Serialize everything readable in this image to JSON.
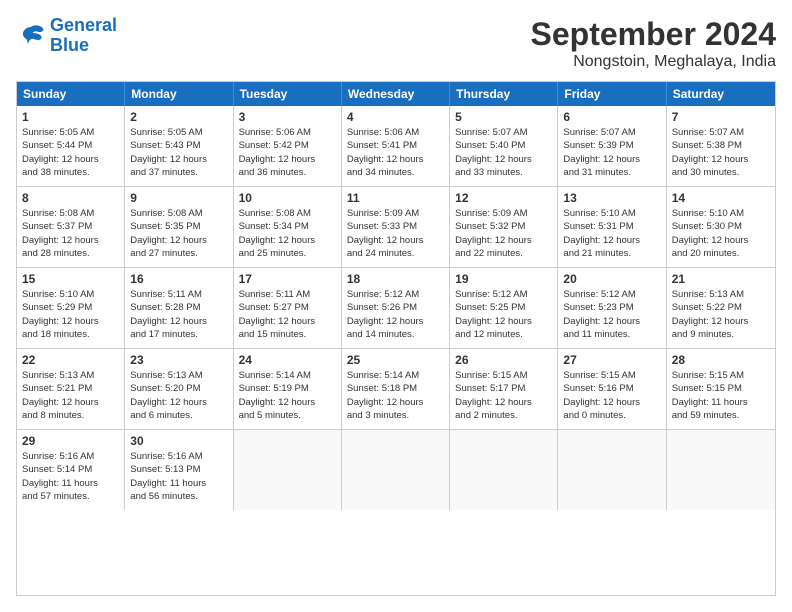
{
  "logo": {
    "line1": "General",
    "line2": "Blue"
  },
  "title": "September 2024",
  "subtitle": "Nongstoin, Meghalaya, India",
  "days": [
    "Sunday",
    "Monday",
    "Tuesday",
    "Wednesday",
    "Thursday",
    "Friday",
    "Saturday"
  ],
  "weeks": [
    [
      {
        "num": "1",
        "lines": [
          "Sunrise: 5:05 AM",
          "Sunset: 5:44 PM",
          "Daylight: 12 hours",
          "and 38 minutes."
        ]
      },
      {
        "num": "2",
        "lines": [
          "Sunrise: 5:05 AM",
          "Sunset: 5:43 PM",
          "Daylight: 12 hours",
          "and 37 minutes."
        ]
      },
      {
        "num": "3",
        "lines": [
          "Sunrise: 5:06 AM",
          "Sunset: 5:42 PM",
          "Daylight: 12 hours",
          "and 36 minutes."
        ]
      },
      {
        "num": "4",
        "lines": [
          "Sunrise: 5:06 AM",
          "Sunset: 5:41 PM",
          "Daylight: 12 hours",
          "and 34 minutes."
        ]
      },
      {
        "num": "5",
        "lines": [
          "Sunrise: 5:07 AM",
          "Sunset: 5:40 PM",
          "Daylight: 12 hours",
          "and 33 minutes."
        ]
      },
      {
        "num": "6",
        "lines": [
          "Sunrise: 5:07 AM",
          "Sunset: 5:39 PM",
          "Daylight: 12 hours",
          "and 31 minutes."
        ]
      },
      {
        "num": "7",
        "lines": [
          "Sunrise: 5:07 AM",
          "Sunset: 5:38 PM",
          "Daylight: 12 hours",
          "and 30 minutes."
        ]
      }
    ],
    [
      {
        "num": "8",
        "lines": [
          "Sunrise: 5:08 AM",
          "Sunset: 5:37 PM",
          "Daylight: 12 hours",
          "and 28 minutes."
        ]
      },
      {
        "num": "9",
        "lines": [
          "Sunrise: 5:08 AM",
          "Sunset: 5:35 PM",
          "Daylight: 12 hours",
          "and 27 minutes."
        ]
      },
      {
        "num": "10",
        "lines": [
          "Sunrise: 5:08 AM",
          "Sunset: 5:34 PM",
          "Daylight: 12 hours",
          "and 25 minutes."
        ]
      },
      {
        "num": "11",
        "lines": [
          "Sunrise: 5:09 AM",
          "Sunset: 5:33 PM",
          "Daylight: 12 hours",
          "and 24 minutes."
        ]
      },
      {
        "num": "12",
        "lines": [
          "Sunrise: 5:09 AM",
          "Sunset: 5:32 PM",
          "Daylight: 12 hours",
          "and 22 minutes."
        ]
      },
      {
        "num": "13",
        "lines": [
          "Sunrise: 5:10 AM",
          "Sunset: 5:31 PM",
          "Daylight: 12 hours",
          "and 21 minutes."
        ]
      },
      {
        "num": "14",
        "lines": [
          "Sunrise: 5:10 AM",
          "Sunset: 5:30 PM",
          "Daylight: 12 hours",
          "and 20 minutes."
        ]
      }
    ],
    [
      {
        "num": "15",
        "lines": [
          "Sunrise: 5:10 AM",
          "Sunset: 5:29 PM",
          "Daylight: 12 hours",
          "and 18 minutes."
        ]
      },
      {
        "num": "16",
        "lines": [
          "Sunrise: 5:11 AM",
          "Sunset: 5:28 PM",
          "Daylight: 12 hours",
          "and 17 minutes."
        ]
      },
      {
        "num": "17",
        "lines": [
          "Sunrise: 5:11 AM",
          "Sunset: 5:27 PM",
          "Daylight: 12 hours",
          "and 15 minutes."
        ]
      },
      {
        "num": "18",
        "lines": [
          "Sunrise: 5:12 AM",
          "Sunset: 5:26 PM",
          "Daylight: 12 hours",
          "and 14 minutes."
        ]
      },
      {
        "num": "19",
        "lines": [
          "Sunrise: 5:12 AM",
          "Sunset: 5:25 PM",
          "Daylight: 12 hours",
          "and 12 minutes."
        ]
      },
      {
        "num": "20",
        "lines": [
          "Sunrise: 5:12 AM",
          "Sunset: 5:23 PM",
          "Daylight: 12 hours",
          "and 11 minutes."
        ]
      },
      {
        "num": "21",
        "lines": [
          "Sunrise: 5:13 AM",
          "Sunset: 5:22 PM",
          "Daylight: 12 hours",
          "and 9 minutes."
        ]
      }
    ],
    [
      {
        "num": "22",
        "lines": [
          "Sunrise: 5:13 AM",
          "Sunset: 5:21 PM",
          "Daylight: 12 hours",
          "and 8 minutes."
        ]
      },
      {
        "num": "23",
        "lines": [
          "Sunrise: 5:13 AM",
          "Sunset: 5:20 PM",
          "Daylight: 12 hours",
          "and 6 minutes."
        ]
      },
      {
        "num": "24",
        "lines": [
          "Sunrise: 5:14 AM",
          "Sunset: 5:19 PM",
          "Daylight: 12 hours",
          "and 5 minutes."
        ]
      },
      {
        "num": "25",
        "lines": [
          "Sunrise: 5:14 AM",
          "Sunset: 5:18 PM",
          "Daylight: 12 hours",
          "and 3 minutes."
        ]
      },
      {
        "num": "26",
        "lines": [
          "Sunrise: 5:15 AM",
          "Sunset: 5:17 PM",
          "Daylight: 12 hours",
          "and 2 minutes."
        ]
      },
      {
        "num": "27",
        "lines": [
          "Sunrise: 5:15 AM",
          "Sunset: 5:16 PM",
          "Daylight: 12 hours",
          "and 0 minutes."
        ]
      },
      {
        "num": "28",
        "lines": [
          "Sunrise: 5:15 AM",
          "Sunset: 5:15 PM",
          "Daylight: 11 hours",
          "and 59 minutes."
        ]
      }
    ],
    [
      {
        "num": "29",
        "lines": [
          "Sunrise: 5:16 AM",
          "Sunset: 5:14 PM",
          "Daylight: 11 hours",
          "and 57 minutes."
        ]
      },
      {
        "num": "30",
        "lines": [
          "Sunrise: 5:16 AM",
          "Sunset: 5:13 PM",
          "Daylight: 11 hours",
          "and 56 minutes."
        ]
      },
      {
        "num": "",
        "lines": []
      },
      {
        "num": "",
        "lines": []
      },
      {
        "num": "",
        "lines": []
      },
      {
        "num": "",
        "lines": []
      },
      {
        "num": "",
        "lines": []
      }
    ]
  ]
}
